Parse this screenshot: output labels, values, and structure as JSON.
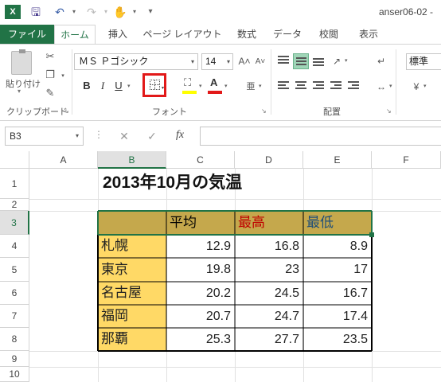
{
  "titlebar": {
    "app_icon": "X",
    "icons": [
      "excel-icon",
      "save-icon",
      "undo-icon",
      "redo-icon",
      "touch-mode-icon",
      "customize-icon"
    ],
    "document_title": "anser06-02 -"
  },
  "tabs": {
    "file": "ファイル",
    "home": "ホーム",
    "insert": "挿入",
    "page_layout": "ページ レイアウト",
    "formulas": "数式",
    "data": "データ",
    "review": "校閲",
    "view": "表示"
  },
  "ribbon": {
    "clipboard": {
      "paste_label": "貼り付け",
      "group_label": "クリップボード"
    },
    "font": {
      "font_name": "ＭＳ Ｐゴシック",
      "font_size": "14",
      "bold": "B",
      "italic": "I",
      "underline": "U",
      "font_color_glyph": "A",
      "fill_color": "#ffff00",
      "font_color": "#e21919",
      "highlight_color": "#e21919",
      "group_label": "フォント"
    },
    "alignment": {
      "group_label": "配置"
    },
    "number": {
      "format": "標準"
    }
  },
  "formula_bar": {
    "name_box": "B3",
    "fx_label": "fx",
    "formula": ""
  },
  "sheet": {
    "columns": [
      "A",
      "B",
      "C",
      "D",
      "E",
      "F"
    ],
    "selected_column": "B",
    "rows": [
      "1",
      "2",
      "3",
      "4",
      "5",
      "6",
      "7",
      "8",
      "9",
      "10"
    ],
    "selected_row": "3",
    "title": "2013年10月の気温",
    "headers": {
      "avg": "平均",
      "high": "最高",
      "low": "最低"
    },
    "header_colors": {
      "bg": "#c5a84c",
      "avg": "#000000",
      "high": "#c00000",
      "low": "#1f4e79"
    },
    "city_bg": "#ffd966",
    "table": [
      {
        "city": "札幌",
        "avg": "12.9",
        "high": "16.8",
        "low": "8.9"
      },
      {
        "city": "東京",
        "avg": "19.8",
        "high": "23",
        "low": "17"
      },
      {
        "city": "名古屋",
        "avg": "20.2",
        "high": "24.5",
        "low": "16.7"
      },
      {
        "city": "福岡",
        "avg": "20.7",
        "high": "24.7",
        "low": "17.4"
      },
      {
        "city": "那覇",
        "avg": "25.3",
        "high": "27.7",
        "low": "23.5"
      }
    ]
  }
}
